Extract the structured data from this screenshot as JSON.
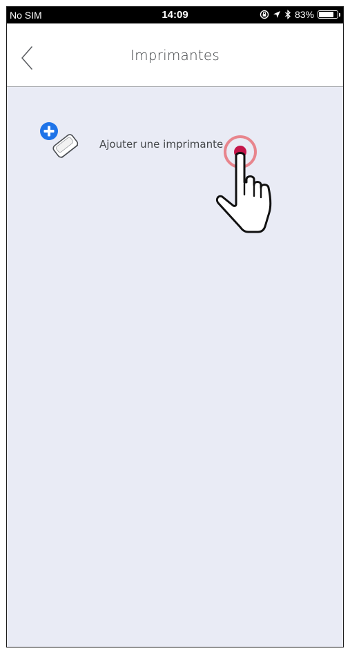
{
  "status_bar": {
    "carrier": "No SIM",
    "time": "14:09",
    "battery": "83%",
    "battery_level": 0.83,
    "icons": [
      "orientation-lock-icon",
      "location-arrow-icon",
      "bluetooth-icon",
      "battery-icon"
    ]
  },
  "nav": {
    "title": "Imprimantes",
    "back_icon": "chevron-left-icon"
  },
  "content": {
    "add_printer_label": "Ajouter une imprimante",
    "add_printer_icon": "printer-add-icon",
    "tap_indicator_icon": "hand-pointer-icon"
  },
  "colors": {
    "background": "#e9ebf5",
    "accent_blue": "#1e73e8",
    "tap_ring": "#e8737a",
    "tap_dot": "#c4164a"
  }
}
